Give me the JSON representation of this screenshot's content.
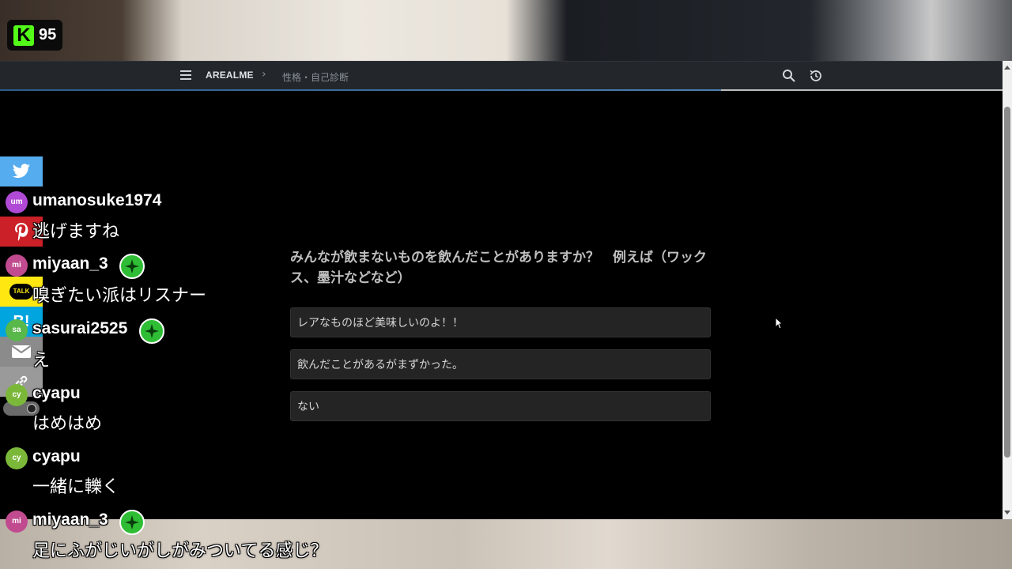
{
  "stream_badge": {
    "logo": "K",
    "count": "95"
  },
  "navbar": {
    "brand": "AREALME",
    "separator": "›",
    "breadcrumb": "性格・自己診断",
    "icons": [
      "menu-icon",
      "search-icon",
      "history-icon"
    ]
  },
  "quiz": {
    "question": "みんなが飲まないものを飲んだことがありますか？　例えば（ワックス、墨汁などなど）",
    "options": [
      "レアなものほど美味しいのよ！！",
      "飲んだことがあるがまずかった。",
      "ない"
    ]
  },
  "share_bar": {
    "buttons": [
      "twitter-icon",
      "pinterest-icon",
      "line-icon",
      "hatena-icon",
      "mail-icon",
      "link-icon"
    ],
    "line_label": "TALK",
    "hatena_label": "B!",
    "colors": {
      "twitter": "#55acee",
      "pinterest": "#cb2027",
      "line": "#ffe812",
      "hatena": "#00a4de"
    }
  },
  "chat": [
    {
      "avatar": "um",
      "avatar_color": "#b04ad6",
      "user": "umanosuke1974",
      "message": "逃げますね",
      "subscriber": false
    },
    {
      "avatar": "mi",
      "avatar_color": "#c04b8f",
      "user": "miyaan_3",
      "message": "嗅ぎたい派はリスナー",
      "subscriber": true
    },
    {
      "avatar": "sa",
      "avatar_color": "#58b84a",
      "user": "sasurai2525",
      "message": "え",
      "subscriber": true
    },
    {
      "avatar": "cy",
      "avatar_color": "#7bb83a",
      "user": "cyapu",
      "message": "はめはめ",
      "subscriber": false
    },
    {
      "avatar": "cy",
      "avatar_color": "#7bb83a",
      "user": "cyapu",
      "message": "一緒に轢く",
      "subscriber": false
    },
    {
      "avatar": "mi",
      "avatar_color": "#c04b8f",
      "user": "miyaan_3",
      "message": "足にふがじいがしがみついてる感じ？",
      "subscriber": true
    }
  ]
}
